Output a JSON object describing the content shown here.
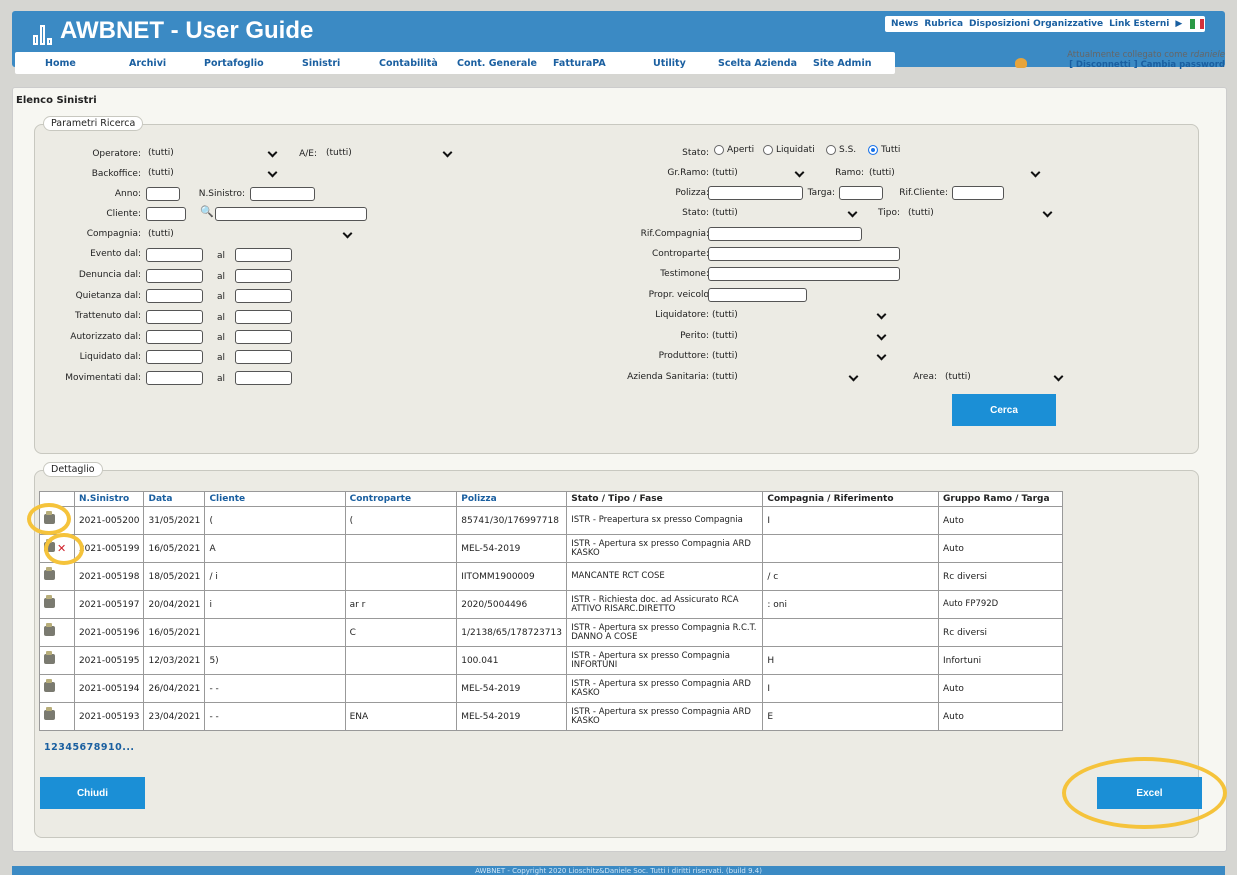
{
  "header": {
    "title": "AWBNET - User Guide",
    "top_links": [
      "News",
      "Rubrica",
      "Disposizioni Organizzative",
      "Link Esterni"
    ],
    "nav": [
      "Home",
      "Archivi",
      "Portafoglio",
      "Sinistri",
      "Contabilità",
      "Cont. Generale",
      "FatturaPA",
      "Utility",
      "Scelta Azienda",
      "Site Admin"
    ],
    "user_line": "Attualmente collegato come",
    "user_name": "rdaniele",
    "disconnect": "Disconnetti",
    "change_password": "Cambia password"
  },
  "page_title": "Elenco Sinistri",
  "search": {
    "legend": "Parametri Ricerca",
    "operatore_label": "Operatore:",
    "operatore_value": "(tutti)",
    "ae_label": "A/E:",
    "ae_value": "(tutti)",
    "backoffice_label": "Backoffice:",
    "backoffice_value": "(tutti)",
    "anno_label": "Anno:",
    "nsinistro_label": "N.Sinistro:",
    "cliente_label": "Cliente:",
    "compagnia_label": "Compagnia:",
    "compagnia_value": "(tutti)",
    "date_labels": [
      "Evento dal:",
      "Denuncia dal:",
      "Quietanza dal:",
      "Trattenuto dal:",
      "Autorizzato dal:",
      "Liquidato dal:",
      "Movimentati dal:"
    ],
    "al_label": "al",
    "stato_label": "Stato:",
    "stato_options": [
      "Aperti",
      "Liquidati",
      "S.S.",
      "Tutti"
    ],
    "stato_selected": "Tutti",
    "grramo_label": "Gr.Ramo:",
    "grramo_value": "(tutti)",
    "ramo_label": "Ramo:",
    "ramo_value": "(tutti)",
    "polizza_label": "Polizza:",
    "targa_label": "Targa:",
    "rifcliente_label": "Rif.Cliente:",
    "stato2_label": "Stato:",
    "stato2_value": "(tutti)",
    "tipo_label": "Tipo:",
    "tipo_value": "(tutti)",
    "rifcompagnia_label": "Rif.Compagnia:",
    "controparte_label": "Controparte:",
    "testimone_label": "Testimone:",
    "proprveicolo_label": "Propr. veicolo",
    "liquidatore_label": "Liquidatore:",
    "liquidatore_value": "(tutti)",
    "perito_label": "Perito:",
    "perito_value": "(tutti)",
    "produttore_label": "Produttore:",
    "produttore_value": "(tutti)",
    "azienda_label": "Azienda Sanitaria:",
    "azienda_value": "(tutti)",
    "area_label": "Area:",
    "area_value": "(tutti)",
    "cerca_label": "Cerca"
  },
  "detail": {
    "legend": "Dettaglio",
    "columns": [
      "N.Sinistro",
      "Data",
      "Cliente",
      "Controparte",
      "Polizza",
      "Stato / Tipo / Fase",
      "Compagnia / Riferimento",
      "Gruppo Ramo / Targa"
    ],
    "rows": [
      {
        "n": "2021-005200",
        "data": "31/05/2021",
        "cliente": "(",
        "controparte": "(",
        "polizza": "85741/30/176997718",
        "stato": "ISTR - Preapertura sx presso Compagnia",
        "compagnia": "I",
        "gruppo": "Auto"
      },
      {
        "n": "2021-005199",
        "data": "16/05/2021",
        "cliente": "A",
        "controparte": "",
        "polizza": "MEL-54-2019",
        "stato": "ISTR - Apertura sx presso Compagnia ARD KASKO",
        "compagnia": "",
        "gruppo": "Auto"
      },
      {
        "n": "2021-005198",
        "data": "18/05/2021",
        "cliente": "/ i",
        "controparte": "",
        "polizza": "IITOMM1900009",
        "stato": "MANCANTE RCT COSE",
        "compagnia": "/ c",
        "gruppo": "Rc diversi"
      },
      {
        "n": "2021-005197",
        "data": "20/04/2021",
        "cliente": "i",
        "controparte": "ar r",
        "polizza": "2020/5004496",
        "stato": "ISTR - Richiesta doc. ad Assicurato RCA ATTIVO RISARC.DIRETTO",
        "compagnia": ": oni",
        "gruppo": "Auto FP792D"
      },
      {
        "n": "2021-005196",
        "data": "16/05/2021",
        "cliente": "",
        "controparte": "C",
        "polizza": "1/2138/65/178723713",
        "stato": "ISTR - Apertura sx presso Compagnia R.C.T. DANNO A COSE",
        "compagnia": "",
        "gruppo": "Rc diversi"
      },
      {
        "n": "2021-005195",
        "data": "12/03/2021",
        "cliente": "5)",
        "controparte": "",
        "polizza": "100.041",
        "stato": "ISTR - Apertura sx presso Compagnia INFORTUNI",
        "compagnia": "H",
        "gruppo": "Infortuni"
      },
      {
        "n": "2021-005194",
        "data": "26/04/2021",
        "cliente": "- -",
        "controparte": "",
        "polizza": "MEL-54-2019",
        "stato": "ISTR - Apertura sx presso Compagnia ARD KASKO",
        "compagnia": "I",
        "gruppo": "Auto"
      },
      {
        "n": "2021-005193",
        "data": "23/04/2021",
        "cliente": "- -",
        "controparte": "ENA",
        "polizza": "MEL-54-2019",
        "stato": "ISTR - Apertura sx presso Compagnia ARD KASKO",
        "compagnia": "E",
        "gruppo": "Auto"
      }
    ],
    "pager": "12345678910...",
    "chiudi_label": "Chiudi",
    "excel_label": "Excel",
    "delete_glyph": "✕"
  },
  "footer": "AWBNET - Copyright 2020 Lioschitz&Daniele Soc. Tutti i diritti riservati. (build 9.4)",
  "colors": {
    "brand": "#3b8ac4",
    "button": "#1b8fd6",
    "highlight": "#f5c33b"
  }
}
